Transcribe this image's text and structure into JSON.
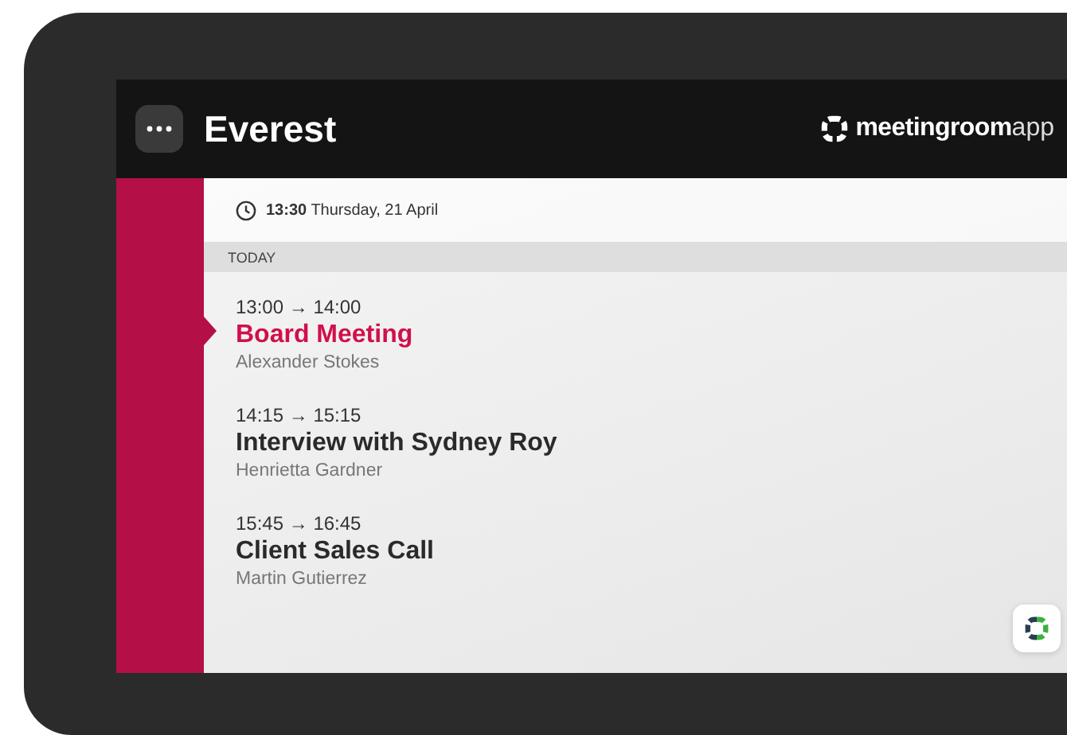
{
  "header": {
    "room_name": "Everest",
    "logo": {
      "primary": "meetingroom",
      "secondary": "app"
    }
  },
  "clock": {
    "time": "13:30",
    "date": "Thursday, 21 April"
  },
  "day_label": "TODAY",
  "meetings": [
    {
      "time": "13:00 → 14:00",
      "title": "Board Meeting",
      "organizer": "Alexander Stokes",
      "current": true
    },
    {
      "time": "14:15 → 15:15",
      "title": "Interview with Sydney Roy",
      "organizer": "Henrietta Gardner",
      "current": false
    },
    {
      "time": "15:45 → 16:45",
      "title": "Client Sales Call",
      "organizer": "Martin Gutierrez",
      "current": false
    }
  ]
}
